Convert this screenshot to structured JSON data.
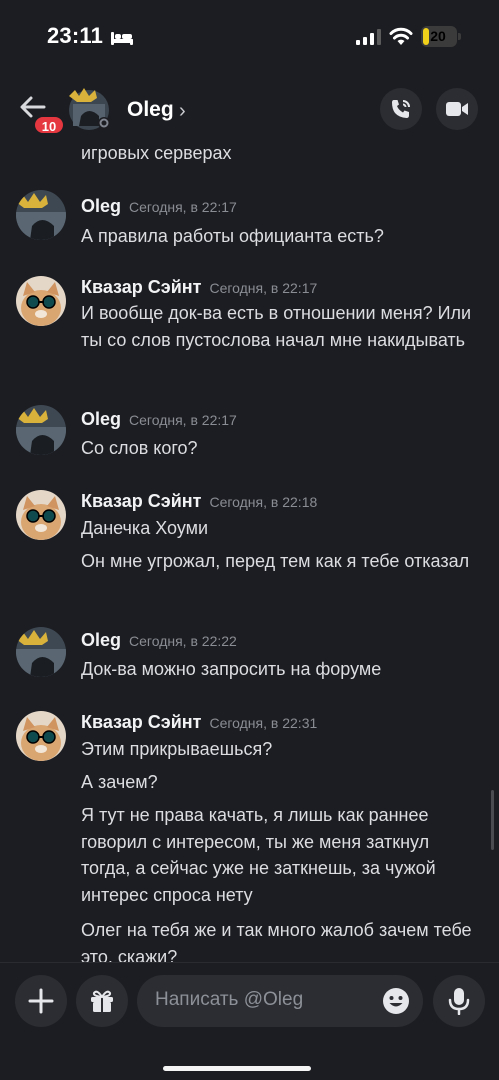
{
  "status_bar": {
    "time": "23:11",
    "battery": "20",
    "battery_level": 0.2,
    "icons": [
      "bed-icon",
      "cellular-signal-icon",
      "wifi-icon",
      "battery-icon"
    ]
  },
  "header": {
    "back_badge": "10",
    "title": "Oleg",
    "chevron": "›",
    "icons": [
      "back-arrow-icon",
      "chevron-right-icon",
      "phone-call-icon",
      "video-camera-icon"
    ]
  },
  "messages": {
    "clipped_text": "игровых серверах",
    "groups": [
      {
        "author": "Oleg",
        "time": "Сегодня, в 22:17",
        "lines": [
          "А правила работы официанта есть?"
        ]
      },
      {
        "author": "Квазар Сэйнт",
        "time": "Сегодня, в 22:17",
        "lines": [
          "И вообще док-ва есть в отношении меня? Или ты со слов пустослова начал мне накидывать"
        ]
      },
      {
        "author": "Oleg",
        "time": "Сегодня, в 22:17",
        "lines": [
          "Со слов кого?"
        ]
      },
      {
        "author": "Квазар Сэйнт",
        "time": "Сегодня, в 22:18",
        "lines": [
          "Данечка Хоуми",
          "Он мне угрожал, перед тем как я тебе отказал"
        ]
      },
      {
        "author": "Oleg",
        "time": "Сегодня, в 22:22",
        "lines": [
          "Док-ва можно запросить на форуме"
        ]
      },
      {
        "author": "Квазар Сэйнт",
        "time": "Сегодня, в 22:31",
        "lines": [
          "Этим прикрываешься?",
          "А зачем?",
          "Я тут не права качать, я лишь как раннее говорил с интересом, ты же меня заткнул тогда, а сейчас уже не заткнешь, за чужой интерес спроса нету",
          "Олег на тебя же и так много жалоб зачем тебе это, скажи?"
        ]
      }
    ]
  },
  "composer": {
    "placeholder": "Написать @Oleg",
    "icons": [
      "plus-icon",
      "gift-icon",
      "emoji-icon",
      "microphone-icon"
    ]
  },
  "colors": {
    "background": "#1c1d22",
    "surface": "#2b2d33",
    "badge": "#e5373f",
    "battery": "#f2d11a",
    "timestamp": "#8a8d94"
  }
}
